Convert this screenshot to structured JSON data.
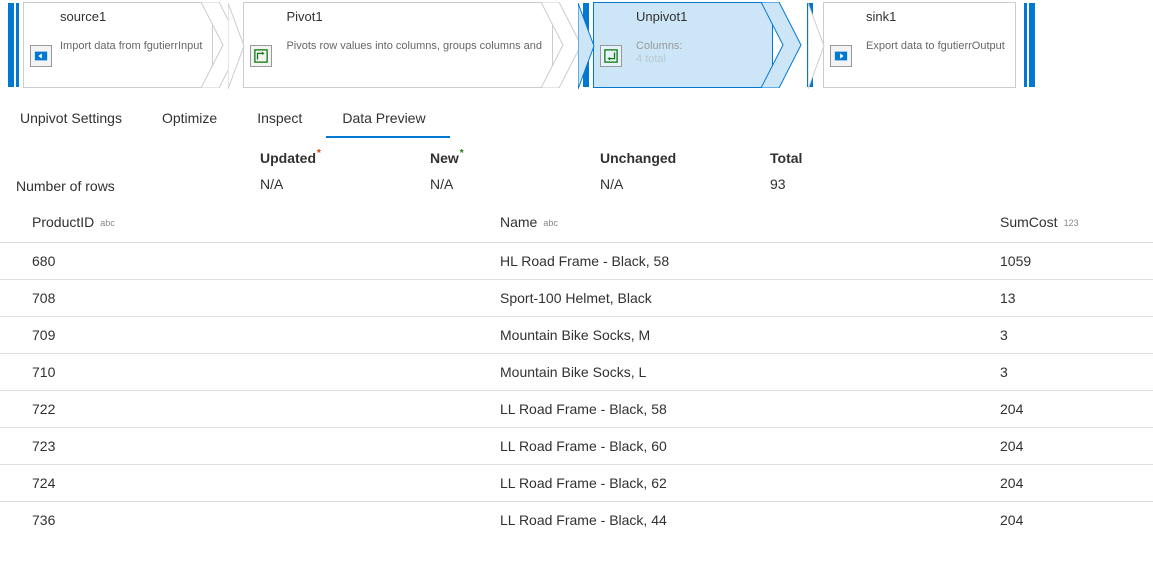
{
  "flow": {
    "nodes": [
      {
        "title": "source1",
        "desc": "Import data from fgutierrInput",
        "selected": false,
        "icon": "source"
      },
      {
        "title": "Pivot1",
        "desc": "Pivots row values into columns, groups columns and",
        "selected": false,
        "icon": "pivot"
      },
      {
        "title": "Unpivot1",
        "desc": "Columns:",
        "desc2": "4 total",
        "selected": true,
        "icon": "unpivot"
      },
      {
        "title": "sink1",
        "desc": "Export data to fgutierrOutput",
        "selected": false,
        "icon": "sink"
      }
    ]
  },
  "tabs": {
    "items": [
      {
        "label": "Unpivot Settings"
      },
      {
        "label": "Optimize"
      },
      {
        "label": "Inspect"
      },
      {
        "label": "Data Preview"
      }
    ],
    "activeIndex": 3
  },
  "stats": {
    "rowLabel": "Number of rows",
    "cols": [
      {
        "head": "Updated",
        "sup": "*",
        "supClass": "sup-orange",
        "val": "N/A"
      },
      {
        "head": "New",
        "sup": "*",
        "supClass": "sup-green",
        "val": "N/A"
      },
      {
        "head": "Unchanged",
        "sup": "",
        "supClass": "",
        "val": "N/A"
      },
      {
        "head": "Total",
        "sup": "",
        "supClass": "",
        "val": "93"
      }
    ]
  },
  "table": {
    "columns": [
      {
        "label": "ProductID",
        "type": "abc"
      },
      {
        "label": "Name",
        "type": "abc"
      },
      {
        "label": "SumCost",
        "type": "123"
      }
    ],
    "rows": [
      {
        "id": "680",
        "name": "HL Road Frame - Black, 58",
        "cost": "1059"
      },
      {
        "id": "708",
        "name": "Sport-100 Helmet, Black",
        "cost": "13"
      },
      {
        "id": "709",
        "name": "Mountain Bike Socks, M",
        "cost": "3"
      },
      {
        "id": "710",
        "name": "Mountain Bike Socks, L",
        "cost": "3"
      },
      {
        "id": "722",
        "name": "LL Road Frame - Black, 58",
        "cost": "204"
      },
      {
        "id": "723",
        "name": "LL Road Frame - Black, 60",
        "cost": "204"
      },
      {
        "id": "724",
        "name": "LL Road Frame - Black, 62",
        "cost": "204"
      },
      {
        "id": "736",
        "name": "LL Road Frame - Black, 44",
        "cost": "204"
      }
    ]
  }
}
